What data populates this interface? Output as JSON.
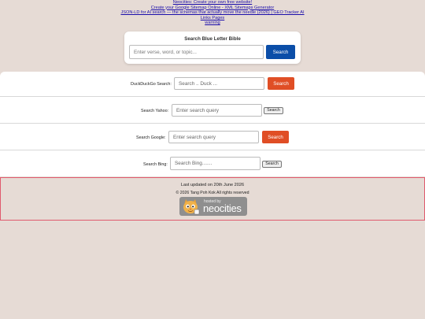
{
  "top_links": [
    "Neocities: Create your own free website!",
    "Create your Google Sitemap Online - XML Sitemaps Generator",
    "JSON-LD for AI search — the schemas that actually move the needle (2026) | GEO Tracker AI",
    "Links Pages",
    "warning"
  ],
  "blb": {
    "title": "Search Blue Letter Bible",
    "placeholder": "Enter verse, word, or topic...",
    "button": "Search",
    "button_color": "#0b4ea8"
  },
  "engines": {
    "duckduckgo": {
      "label": "DuckDuckGo Search:",
      "placeholder": "Search .. Duck ...",
      "button": "Search"
    },
    "yahoo": {
      "label": "Search Yahoo:",
      "placeholder": "Enter search query",
      "button": "Search"
    },
    "google": {
      "label": "Search Google:",
      "placeholder": "Enter search query",
      "button": "Search"
    },
    "bing": {
      "label": "Search Bing:",
      "placeholder": "Search Bing.......",
      "button": "Search"
    }
  },
  "accent_red": "#e04e25",
  "footer": {
    "updated": "Last updated on 20th June 2026",
    "copyright": "© 2026 Tang Poh Kok All rights reserved",
    "badge_small": "hosted by",
    "badge_big": "neocities"
  }
}
